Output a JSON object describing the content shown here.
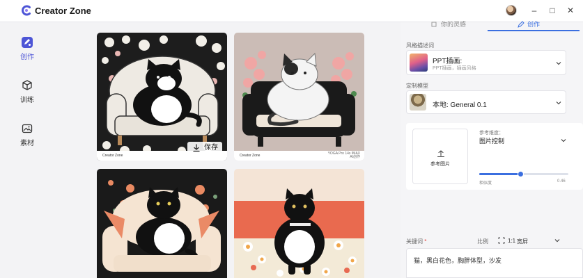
{
  "app": {
    "title": "Creator Zone"
  },
  "window_controls": {
    "minimize": "–",
    "maximize": "□",
    "close": "✕"
  },
  "sidebar": {
    "items": [
      {
        "label": "创作",
        "icon": "create-icon",
        "active": true
      },
      {
        "label": "训练",
        "icon": "cube-icon",
        "active": false
      },
      {
        "label": "素材",
        "icon": "image-folder-icon",
        "active": false
      }
    ]
  },
  "gallery": {
    "save_label": "保存",
    "footer_brand": "Creator Zone",
    "footer_meta": [
      "YOGA Pro 14s IMAX",
      "AI创作"
    ],
    "cards": [
      {
        "name": "cat-on-white-sofa-with-flowers"
      },
      {
        "name": "white-cat-on-black-sofa-pink-flowers"
      },
      {
        "name": "black-white-cat-on-armchair-dark-bg"
      },
      {
        "name": "cat-on-floral-sofa-orange-bg"
      }
    ]
  },
  "panel": {
    "tabs": [
      {
        "label": "你的灵感"
      },
      {
        "label": "创作"
      }
    ],
    "style_section_label": "风格描述词",
    "style": {
      "title": "PPT插画:",
      "subtitle": "PPT插画，插画风格"
    },
    "model_section_label": "定制模型",
    "model": {
      "title": "本地: General 0.1"
    },
    "reference": {
      "upload_label": "参考图片",
      "dimension_label": "参考维度：",
      "dimension_value": "图片控制",
      "similarity_label": "相似度",
      "similarity_value": "0.46",
      "similarity": 0.46
    },
    "keywords": {
      "label": "关键词",
      "required_mark": "*",
      "ratio_label": "比例",
      "ratio_value": "1:1",
      "ratio_name": "宽屏",
      "text": "猫，黑白花色，胸胖体型，沙发"
    }
  },
  "colors": {
    "accent": "#3b6fe0",
    "brand": "#4d55d6"
  }
}
